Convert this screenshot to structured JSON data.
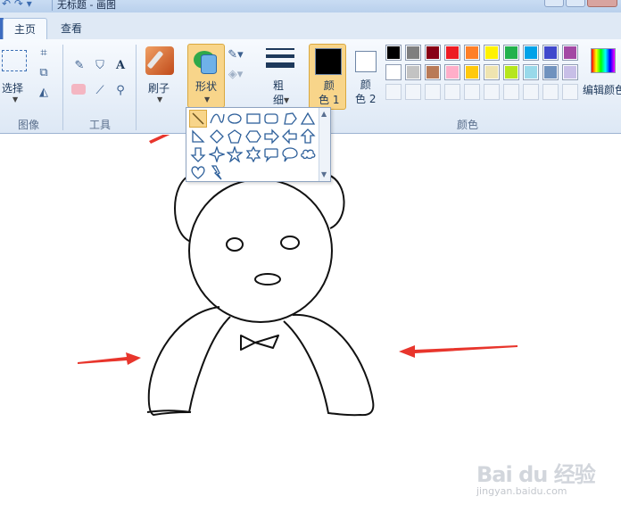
{
  "window": {
    "title": "无标题 - 画图"
  },
  "tabs": [
    {
      "label": "主页"
    },
    {
      "label": "查看"
    }
  ],
  "ribbon": {
    "image_group": {
      "select_label": "选择",
      "group_label": "图像"
    },
    "tools_group": {
      "group_label": "工具",
      "text_tool": "A"
    },
    "brush_label": "刷子",
    "shapes_label": "形状",
    "size_label": "粗\n细",
    "color1_label": "颜\n色 1",
    "color2_label": "颜\n色 2",
    "colors_group_label": "颜色",
    "edit_colors_label": "编辑颜色"
  },
  "palette": {
    "row1": [
      "#000000",
      "#7f7f7f",
      "#880015",
      "#ed1c24",
      "#ff7f27",
      "#fff200",
      "#22b14c",
      "#00a2e8",
      "#3f48cc",
      "#a349a4"
    ],
    "row2": [
      "#ffffff",
      "#c3c3c3",
      "#b97a57",
      "#ffaec9",
      "#ffc90e",
      "#efe4b0",
      "#b5e61d",
      "#99d9ea",
      "#7092be",
      "#c8bfe7"
    ],
    "color1": "#000000",
    "color2": "#ffffff",
    "selected_accent": "#f8d58a"
  },
  "shapes": [
    "line-shape",
    "curve-shape",
    "oval-shape",
    "rectangle-shape",
    "rounded-rectangle-shape",
    "polygon-shape",
    "triangle-shape",
    "right-triangle-shape",
    "diamond-shape",
    "pentagon-shape",
    "hexagon-shape",
    "right-arrow-shape",
    "left-arrow-shape",
    "up-arrow-shape",
    "down-arrow-shape",
    "four-point-star-shape",
    "five-point-star-shape",
    "six-point-star-shape",
    "rounded-callout-shape",
    "oval-callout-shape",
    "cloud-callout-shape",
    "heart-shape",
    "lightning-shape"
  ],
  "annotation_color": "#e8352c",
  "watermark": {
    "main": "Bai du 经验",
    "sub": "jingyan.baidu.com"
  }
}
